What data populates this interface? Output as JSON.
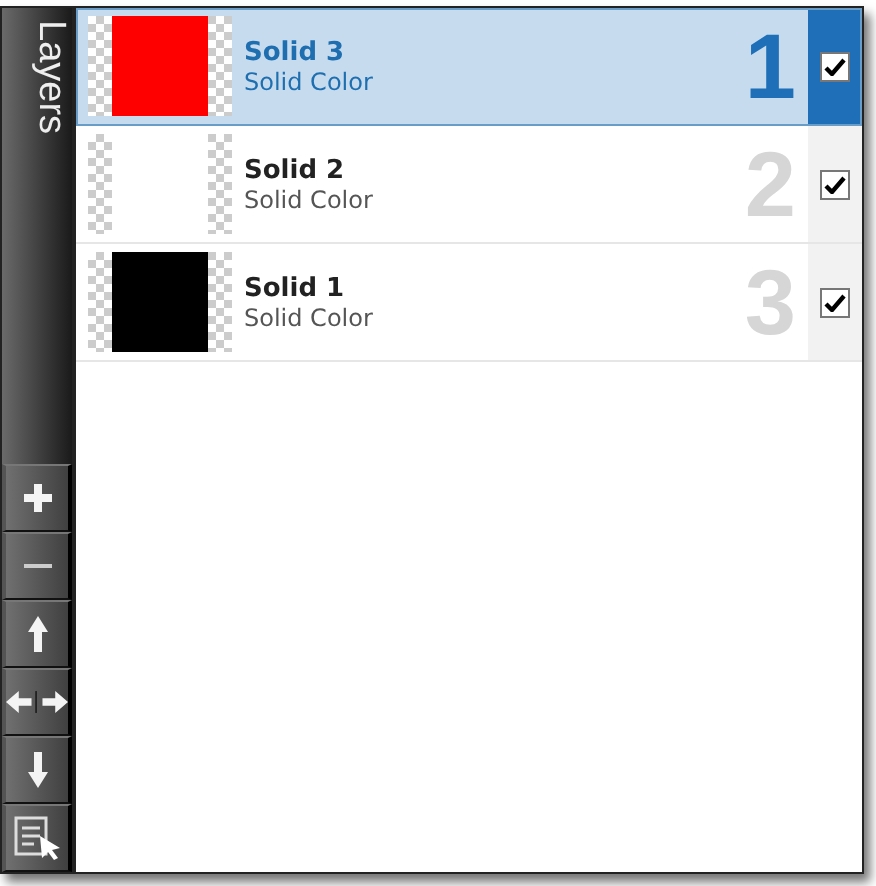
{
  "panel": {
    "title": "Layers"
  },
  "layers": [
    {
      "name": "Solid 3",
      "type": "Solid Color",
      "number": "1",
      "color": "#ff0000",
      "selected": true,
      "visible": true
    },
    {
      "name": "Solid 2",
      "type": "Solid Color",
      "number": "2",
      "color": "#ffffff",
      "selected": false,
      "visible": true
    },
    {
      "name": "Solid 1",
      "type": "Solid Color",
      "number": "3",
      "color": "#000000",
      "selected": false,
      "visible": true
    }
  ],
  "tools": [
    {
      "kind": "add"
    },
    {
      "kind": "remove"
    },
    {
      "kind": "up"
    },
    {
      "kind": "swap"
    },
    {
      "kind": "down"
    },
    {
      "kind": "properties"
    }
  ]
}
